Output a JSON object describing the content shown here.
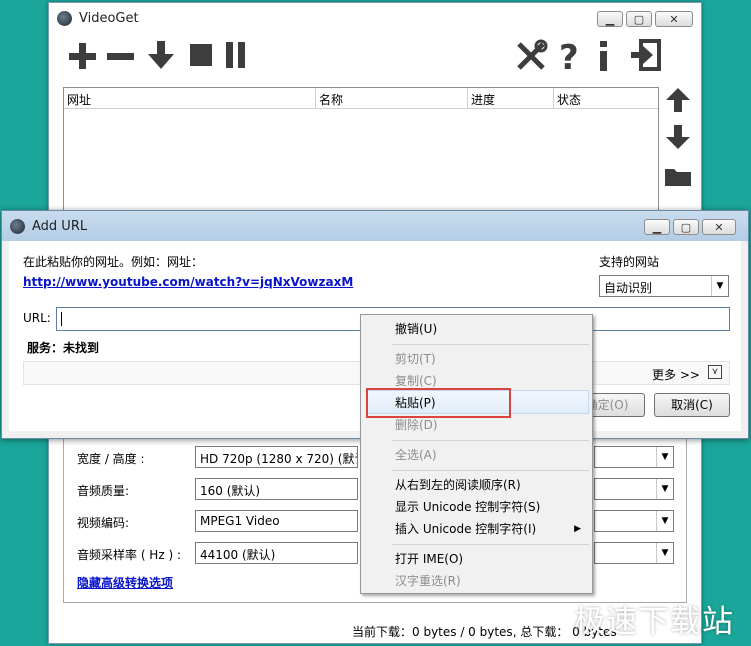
{
  "main_window": {
    "title": "VideoGet",
    "columns": [
      "网址",
      "名称",
      "进度",
      "状态"
    ],
    "status_line": "当前下载：0 bytes / 0 bytes,   总下载：  0 bytes",
    "settings": [
      {
        "label": "宽度 / 高度 :",
        "value": "HD 720p (1280 x 720) (默认"
      },
      {
        "label": "音频质量:",
        "value": "160 (默认)"
      },
      {
        "label": "视频编码:",
        "value": "MPEG1 Video"
      },
      {
        "label": "音频采样率 ( Hz ) :",
        "value": "44100 (默认)"
      }
    ],
    "hide_advanced_link": "隐藏高级转换选项"
  },
  "dialog": {
    "title": "Add URL",
    "instruction": "在此粘贴你的网址。例如：网址：",
    "example_url": "http://www.youtube.com/watch?v=jqNxVowzaxM",
    "supported_sites_label": "支持的网站",
    "site_select_value": "自动识别",
    "url_label": "URL:",
    "url_value": "",
    "service_text": "服务：未找到",
    "more_label": "更多 >>",
    "ok_label": "确定(O)",
    "cancel_label": "取消(C)"
  },
  "context_menu": {
    "items": [
      {
        "label": "撤销(U)",
        "enabled": true
      },
      {
        "label": "剪切(T)",
        "enabled": false
      },
      {
        "label": "复制(C)",
        "enabled": false
      },
      {
        "label": "粘贴(P)",
        "enabled": true
      },
      {
        "label": "删除(D)",
        "enabled": false
      },
      {
        "label": "全选(A)",
        "enabled": false
      },
      {
        "label": "从右到左的阅读顺序(R)",
        "enabled": true
      },
      {
        "label": "显示 Unicode 控制字符(S)",
        "enabled": true
      },
      {
        "label": "插入 Unicode 控制字符(I)",
        "enabled": true
      },
      {
        "label": "打开 IME(O)",
        "enabled": true
      },
      {
        "label": "汉字重选(R)",
        "enabled": false
      }
    ]
  },
  "watermark": "极速下载站",
  "colors": {
    "background": "#1aa69a",
    "link": "#0a14c8",
    "highlight_box": "#d8453f"
  },
  "icons": [
    "add-icon",
    "remove-icon",
    "download-icon",
    "stop-icon",
    "pause-icon",
    "tools-icon",
    "help-icon",
    "info-icon",
    "exit-icon",
    "move-up-icon",
    "move-down-icon",
    "folder-icon"
  ]
}
